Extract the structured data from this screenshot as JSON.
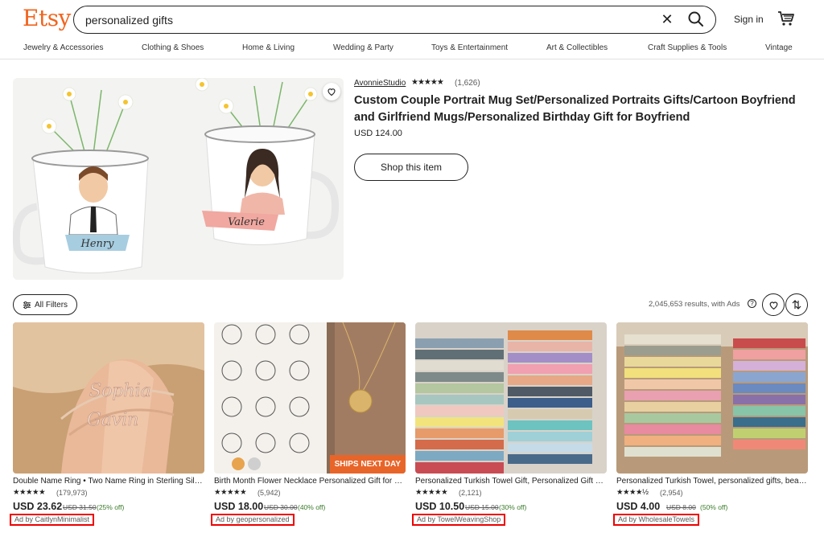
{
  "brand": {
    "logo_text": "Etsy",
    "color": "#f1641e"
  },
  "search": {
    "value": "personalized gifts",
    "clear_icon": "close-icon",
    "submit_icon": "search-icon"
  },
  "header": {
    "signin_label": "Sign in",
    "cart_icon": "cart-icon"
  },
  "categories": [
    "Jewelry & Accessories",
    "Clothing & Shoes",
    "Home & Living",
    "Wedding & Party",
    "Toys & Entertainment",
    "Art & Collectibles",
    "Craft Supplies & Tools",
    "Vintage"
  ],
  "hero": {
    "shop_name": "AvonnieStudio",
    "stars": "★★★★★",
    "rating": 5,
    "reviews": "(1,626)",
    "title": "Custom Couple Portrait Mug Set/Personalized Portraits Gifts/Cartoon Boyfriend and Girlfriend Mugs/Personalized Birthday Gift for Boyfriend",
    "price": "USD 124.00",
    "button_label": "Shop this item",
    "mug_names": [
      "Henry",
      "Valerie"
    ]
  },
  "filters": {
    "all_filters_label": "All Filters",
    "results_text": "2,045,653 results, with Ads",
    "info_icon": "info-icon",
    "heart_icon": "heart-icon",
    "sort_icon": "sort-icon"
  },
  "listings": [
    {
      "title": "Double Name Ring • Two Name Ring in Sterling Silver",
      "stars": "★★★★★",
      "rating": 5,
      "reviews": "(179,973)",
      "price": "USD 23.62",
      "original": "USD 31.50",
      "discount": "(25% off)",
      "ad": "Ad by CaitlynMinimalist",
      "ring_text": [
        "Sophia",
        "Gavin"
      ]
    },
    {
      "title": "Birth Month Flower Necklace Personalized Gift for Her",
      "stars": "★★★★★",
      "rating": 5,
      "reviews": "(5,942)",
      "price": "USD 18.00",
      "original": "USD 30.00",
      "discount": "(40% off)",
      "ad": "Ad by geopersonalized",
      "badge": "SHIPS NEXT DAY"
    },
    {
      "title": "Personalized Turkish Towel Gift, Personalized Gift Set",
      "stars": "★★★★★",
      "rating": 5,
      "reviews": "(2,121)",
      "price": "USD 10.50",
      "original": "USD 15.00",
      "discount": "(30% off)",
      "ad": "Ad by TowelWeavingShop"
    },
    {
      "title": "Personalized Turkish Towel, personalized gifts, beach towel",
      "stars": "★★★★½",
      "rating": 4.5,
      "reviews": "(2,954)",
      "price": "USD 4.00",
      "original": "USD 8.00",
      "discount": "(50% off)",
      "ad": "Ad by WholesaleTowels"
    }
  ]
}
